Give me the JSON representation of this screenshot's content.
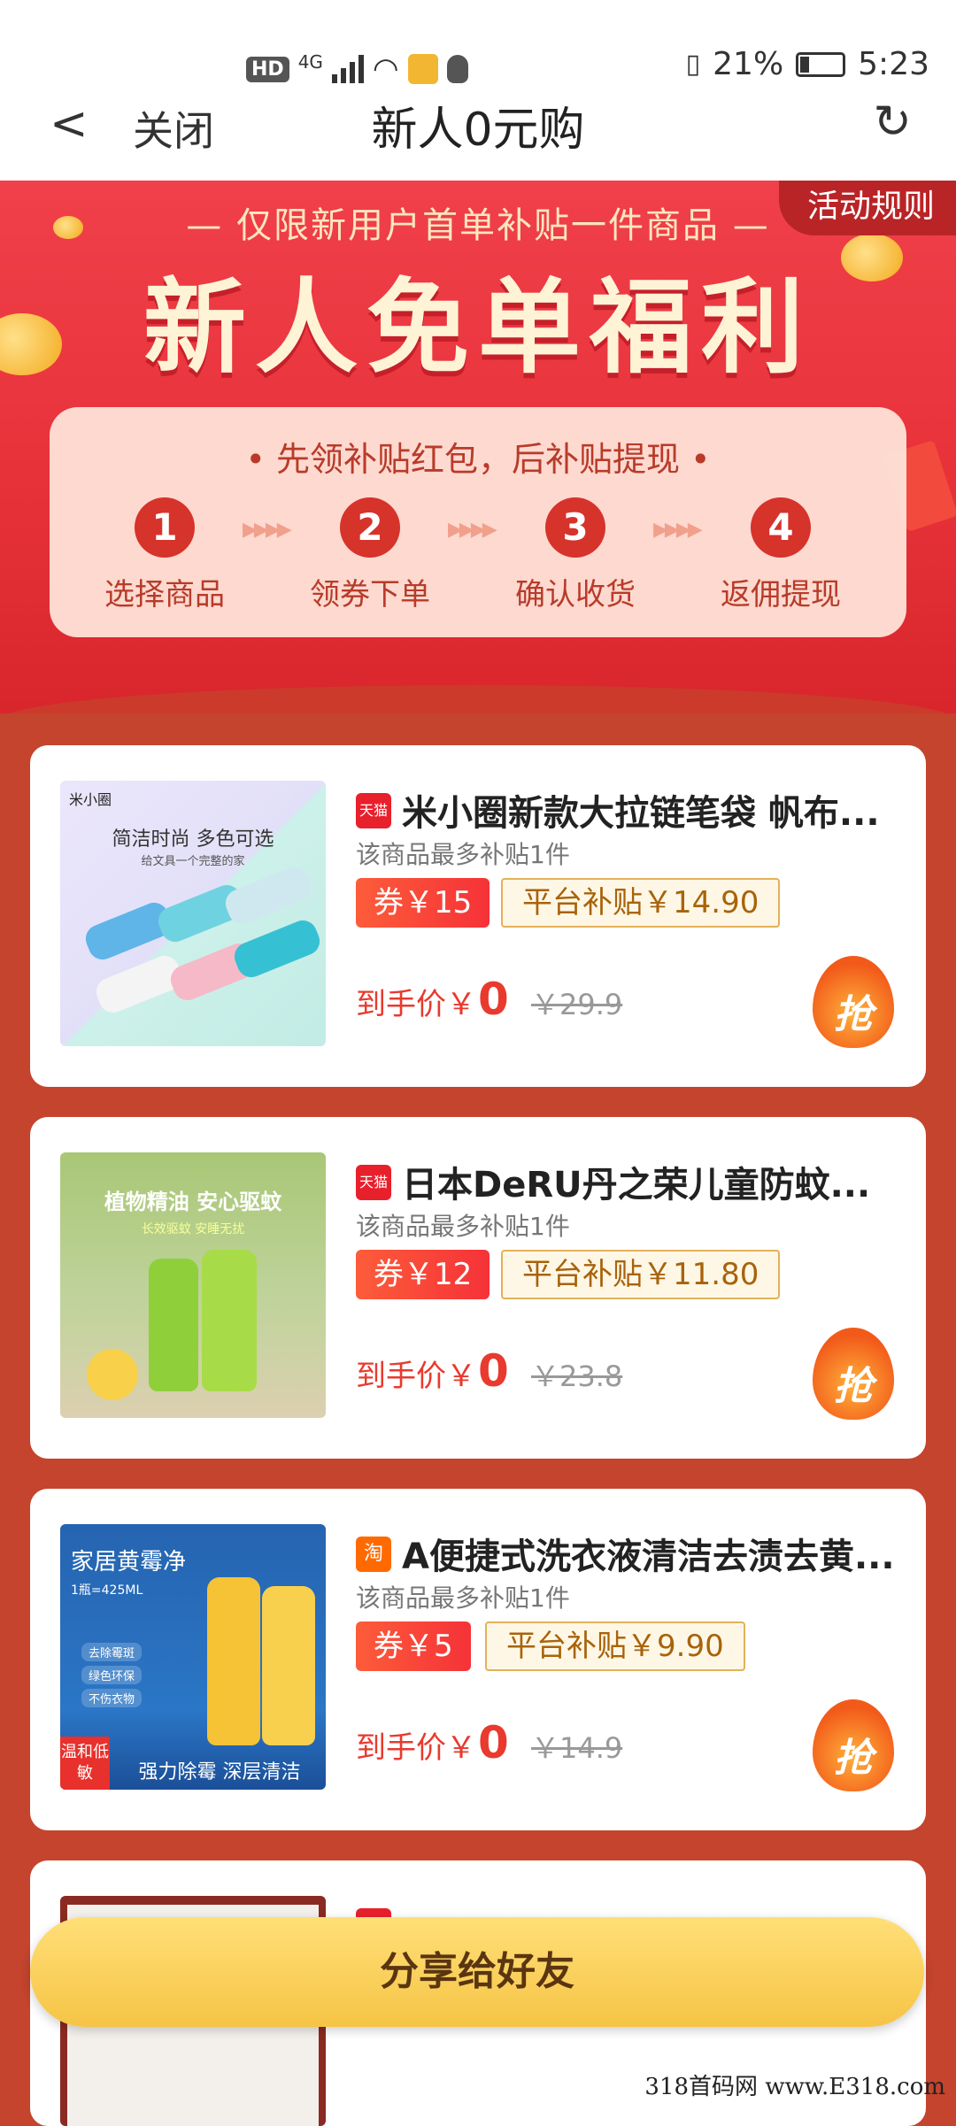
{
  "status_bar": {
    "hd": "HD",
    "network": "4G",
    "battery": "21%",
    "time": "5:23"
  },
  "nav": {
    "close_label": "关闭",
    "title": "新人0元购"
  },
  "banner": {
    "subtitle": "— 仅限新用户首单补贴一件商品 —",
    "title": "新人免单福利",
    "rules_label": "活动规则",
    "steps_heading": "• 先领补贴红包，后补贴提现 •",
    "steps": [
      {
        "num": "1",
        "label": "选择商品"
      },
      {
        "num": "2",
        "label": "领券下单"
      },
      {
        "num": "3",
        "label": "确认收货"
      },
      {
        "num": "4",
        "label": "返佣提现"
      }
    ]
  },
  "products": [
    {
      "shop": "天猫",
      "shop_color": "#e8202c",
      "title": "米小圈新款大拉链笔袋 帆布...",
      "limit": "该商品最多补贴1件",
      "coupon": "券￥15",
      "subsidy": "平台补贴￥14.90",
      "final_label": "到手价￥",
      "final_price": "0",
      "original": "￥29.9",
      "grab": "抢",
      "img_title": "简洁时尚  多色可选",
      "img_sub": "给文具一个完整的家",
      "img_brand": "米小圈"
    },
    {
      "shop": "天猫",
      "shop_color": "#e8202c",
      "title": "日本DeRU丹之荣儿童防蚊...",
      "limit": "该商品最多补贴1件",
      "coupon": "券￥12",
      "subsidy": "平台补贴￥11.80",
      "final_label": "到手价￥",
      "final_price": "0",
      "original": "￥23.8",
      "grab": "抢",
      "img_title": "植物精油  安心驱蚊",
      "img_sub": "长效驱蚊  安睡无扰"
    },
    {
      "shop": "淘",
      "shop_color": "#ff6a00",
      "title": "A便捷式洗衣液清洁去渍去黄...",
      "limit": "该商品最多补贴1件",
      "coupon": "券￥5",
      "subsidy": "平台补贴￥9.90",
      "final_label": "到手价￥",
      "final_price": "0",
      "original": "￥14.9",
      "grab": "抢",
      "img_title": "家居黄霉净",
      "img_sub": "1瓶=425ML",
      "img_feats": [
        "去除霉斑",
        "绿色环保",
        "不伤衣物"
      ],
      "img_badge": "温和低敏",
      "img_bottom": "强力除霉 深层清洁"
    }
  ],
  "share_label": "分享给好友",
  "watermark": "318首码网  www.E318.com"
}
